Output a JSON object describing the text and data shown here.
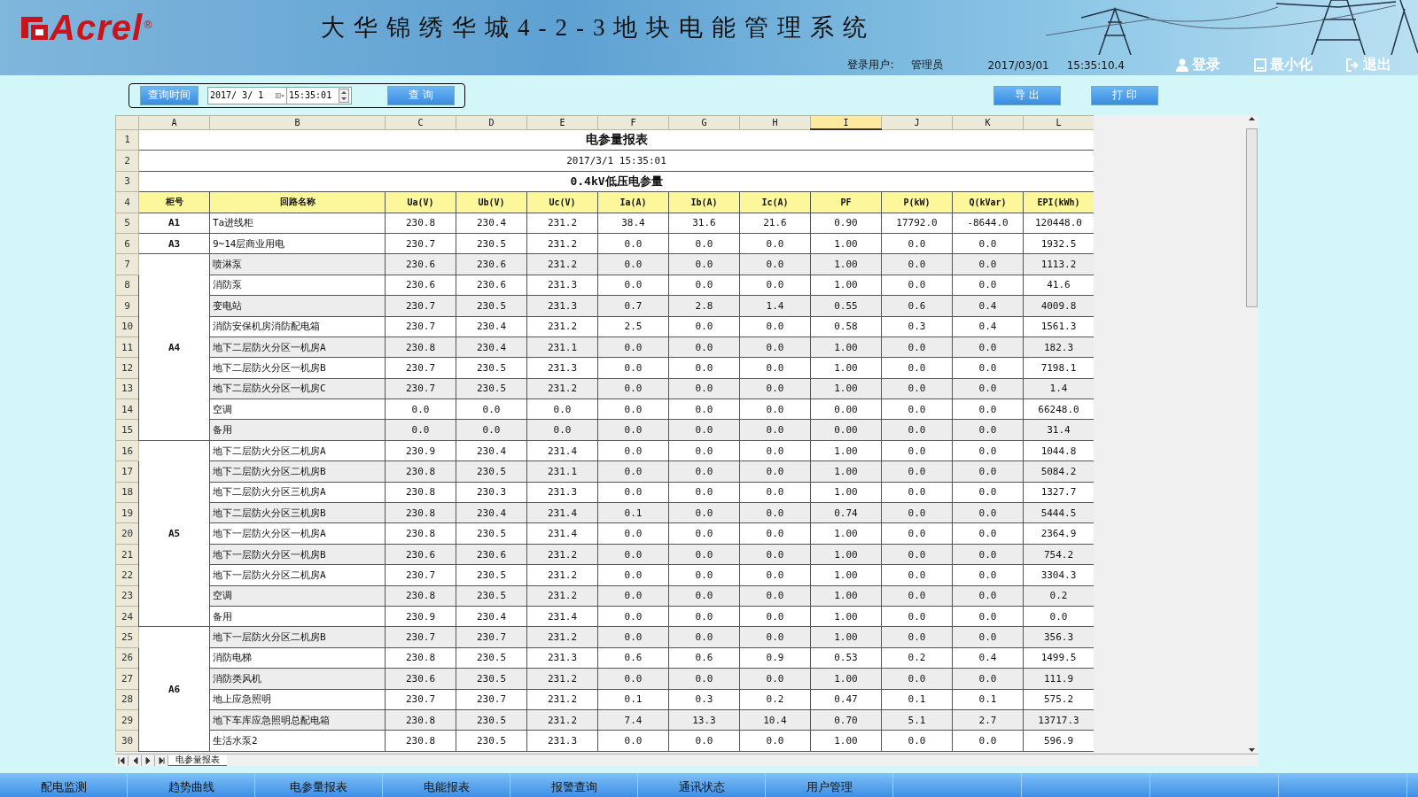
{
  "header": {
    "logo": "Acrel",
    "registered": "®",
    "title": "大华锦绣华城4-2-3地块电能管理系统",
    "user_label": "登录用户:",
    "user": "管理员",
    "date": "2017/03/01",
    "time": "15:35:10.4",
    "buttons": [
      {
        "label": "登录",
        "kind": "login"
      },
      {
        "label": "最小化",
        "kind": "minimize"
      },
      {
        "label": "退出",
        "kind": "exit"
      }
    ]
  },
  "query": {
    "time_button": "查询时间",
    "date": "2017/ 3/ 1",
    "time": "15:35:01",
    "search_button": "查 询",
    "actions": [
      "导 出",
      "打 印"
    ]
  },
  "sheet": {
    "columns": [
      {
        "label": "A",
        "selected": false
      },
      {
        "label": "B",
        "selected": false
      },
      {
        "label": "C",
        "selected": false
      },
      {
        "label": "D",
        "selected": false
      },
      {
        "label": "E",
        "selected": false
      },
      {
        "label": "F",
        "selected": false
      },
      {
        "label": "G",
        "selected": false
      },
      {
        "label": "H",
        "selected": false
      },
      {
        "label": "I",
        "selected": true
      },
      {
        "label": "J",
        "selected": false
      },
      {
        "label": "K",
        "selected": false
      },
      {
        "label": "L",
        "selected": false
      }
    ],
    "row_numbers": [
      "1",
      "2",
      "3",
      "4",
      "5",
      "6",
      "7",
      "8",
      "9",
      "10",
      "11",
      "12",
      "13",
      "14",
      "15",
      "16",
      "17",
      "18",
      "19",
      "20",
      "21",
      "22",
      "23",
      "24",
      "25",
      "26",
      "27",
      "28",
      "29",
      "30"
    ],
    "title": "电参量报表",
    "timestamp": "2017/3/1 15:35:01",
    "subtitle": "0.4kV低压电参量",
    "header": [
      "柜号",
      "回路名称",
      "Ua(V)",
      "Ub(V)",
      "Uc(V)",
      "Ia(A)",
      "Ib(A)",
      "Ic(A)",
      "PF",
      "P(kW)",
      "Q(kVar)",
      "EPI(kWh)"
    ],
    "groups": [
      {
        "cabinet": "A1",
        "rows": [
          [
            "Ta进线柜",
            "230.8",
            "230.4",
            "231.2",
            "38.4",
            "31.6",
            "21.6",
            "0.90",
            "17792.0",
            "-8644.0",
            "120448.0"
          ]
        ]
      },
      {
        "cabinet": "A3",
        "rows": [
          [
            "9~14层商业用电",
            "230.7",
            "230.5",
            "231.2",
            "0.0",
            "0.0",
            "0.0",
            "1.00",
            "0.0",
            "0.0",
            "1932.5"
          ]
        ]
      },
      {
        "cabinet": "A4",
        "rows": [
          [
            "喷淋泵",
            "230.6",
            "230.6",
            "231.2",
            "0.0",
            "0.0",
            "0.0",
            "1.00",
            "0.0",
            "0.0",
            "1113.2"
          ],
          [
            "消防泵",
            "230.6",
            "230.6",
            "231.3",
            "0.0",
            "0.0",
            "0.0",
            "1.00",
            "0.0",
            "0.0",
            "41.6"
          ],
          [
            "变电站",
            "230.7",
            "230.5",
            "231.3",
            "0.7",
            "2.8",
            "1.4",
            "0.55",
            "0.6",
            "0.4",
            "4009.8"
          ],
          [
            "消防安保机房消防配电箱",
            "230.7",
            "230.4",
            "231.2",
            "2.5",
            "0.0",
            "0.0",
            "0.58",
            "0.3",
            "0.4",
            "1561.3"
          ],
          [
            "地下二层防火分区一机房A",
            "230.8",
            "230.4",
            "231.1",
            "0.0",
            "0.0",
            "0.0",
            "1.00",
            "0.0",
            "0.0",
            "182.3"
          ],
          [
            "地下二层防火分区一机房B",
            "230.7",
            "230.5",
            "231.3",
            "0.0",
            "0.0",
            "0.0",
            "1.00",
            "0.0",
            "0.0",
            "7198.1"
          ],
          [
            "地下二层防火分区一机房C",
            "230.7",
            "230.5",
            "231.2",
            "0.0",
            "0.0",
            "0.0",
            "1.00",
            "0.0",
            "0.0",
            "1.4"
          ],
          [
            "空调",
            "0.0",
            "0.0",
            "0.0",
            "0.0",
            "0.0",
            "0.0",
            "0.00",
            "0.0",
            "0.0",
            "66248.0"
          ],
          [
            "备用",
            "0.0",
            "0.0",
            "0.0",
            "0.0",
            "0.0",
            "0.0",
            "0.00",
            "0.0",
            "0.0",
            "31.4"
          ]
        ]
      },
      {
        "cabinet": "A5",
        "rows": [
          [
            "地下二层防火分区二机房A",
            "230.9",
            "230.4",
            "231.4",
            "0.0",
            "0.0",
            "0.0",
            "1.00",
            "0.0",
            "0.0",
            "1044.8"
          ],
          [
            "地下二层防火分区二机房B",
            "230.8",
            "230.5",
            "231.1",
            "0.0",
            "0.0",
            "0.0",
            "1.00",
            "0.0",
            "0.0",
            "5084.2"
          ],
          [
            "地下二层防火分区三机房A",
            "230.8",
            "230.3",
            "231.3",
            "0.0",
            "0.0",
            "0.0",
            "1.00",
            "0.0",
            "0.0",
            "1327.7"
          ],
          [
            "地下二层防火分区三机房B",
            "230.8",
            "230.4",
            "231.4",
            "0.1",
            "0.0",
            "0.0",
            "0.74",
            "0.0",
            "0.0",
            "5444.5"
          ],
          [
            "地下一层防火分区一机房A",
            "230.8",
            "230.5",
            "231.4",
            "0.0",
            "0.0",
            "0.0",
            "1.00",
            "0.0",
            "0.0",
            "2364.9"
          ],
          [
            "地下一层防火分区一机房B",
            "230.6",
            "230.6",
            "231.2",
            "0.0",
            "0.0",
            "0.0",
            "1.00",
            "0.0",
            "0.0",
            "754.2"
          ],
          [
            "地下一层防火分区二机房A",
            "230.7",
            "230.5",
            "231.2",
            "0.0",
            "0.0",
            "0.0",
            "1.00",
            "0.0",
            "0.0",
            "3304.3"
          ],
          [
            "空调",
            "230.8",
            "230.5",
            "231.2",
            "0.0",
            "0.0",
            "0.0",
            "1.00",
            "0.0",
            "0.0",
            "0.2"
          ],
          [
            "备用",
            "230.9",
            "230.4",
            "231.4",
            "0.0",
            "0.0",
            "0.0",
            "1.00",
            "0.0",
            "0.0",
            "0.0"
          ]
        ]
      },
      {
        "cabinet": "A6",
        "rows": [
          [
            "地下一层防火分区二机房B",
            "230.7",
            "230.7",
            "231.2",
            "0.0",
            "0.0",
            "0.0",
            "1.00",
            "0.0",
            "0.0",
            "356.3"
          ],
          [
            "消防电梯",
            "230.8",
            "230.5",
            "231.3",
            "0.6",
            "0.6",
            "0.9",
            "0.53",
            "0.2",
            "0.4",
            "1499.5"
          ],
          [
            "消防类风机",
            "230.6",
            "230.5",
            "231.2",
            "0.0",
            "0.0",
            "0.0",
            "1.00",
            "0.0",
            "0.0",
            "111.9"
          ],
          [
            "地上应急照明",
            "230.7",
            "230.7",
            "231.2",
            "0.1",
            "0.3",
            "0.2",
            "0.47",
            "0.1",
            "0.1",
            "575.2"
          ],
          [
            "地下车库应急照明总配电箱",
            "230.8",
            "230.5",
            "231.2",
            "7.4",
            "13.3",
            "10.4",
            "0.70",
            "5.1",
            "2.7",
            "13717.3"
          ],
          [
            "生活水泵2",
            "230.8",
            "230.5",
            "231.3",
            "0.0",
            "0.0",
            "0.0",
            "1.00",
            "0.0",
            "0.0",
            "596.9"
          ]
        ]
      }
    ],
    "tab": "电参量报表"
  },
  "nav": [
    "配电监测",
    "趋势曲线",
    "电参量报表",
    "电能报表",
    "报警查询",
    "通讯状态",
    "用户管理"
  ]
}
